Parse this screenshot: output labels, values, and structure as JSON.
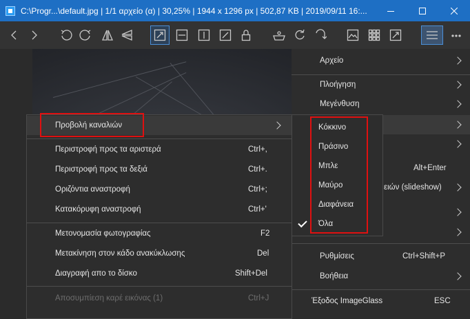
{
  "window": {
    "title": "C:\\Progr...\\default.jpg  |  1/1 αρχείο (α)  |  30,25%  |  1944 x 1296 px  |  502,87 KB  |  2019/09/11 16:..."
  },
  "main_menu": {
    "items": [
      {
        "label": "Αρχείο"
      },
      {
        "label": "Πλοήγηση"
      },
      {
        "label": "Μεγένθυση"
      },
      {
        "label": ""
      },
      {
        "label": ""
      },
      {
        "label": "",
        "shortcut": "Alt+Enter"
      },
      {
        "label": "ειών (slideshow)"
      },
      {
        "label": ""
      },
      {
        "label": ""
      },
      {
        "label": "Ρυθμίσεις",
        "shortcut": "Ctrl+Shift+P"
      },
      {
        "label": "Βοήθεια"
      },
      {
        "label": "Έξοδος ImageGlass",
        "shortcut": "ESC"
      }
    ]
  },
  "sub_menu": {
    "items": [
      {
        "label": "Προβολή καναλιών",
        "shortcut": ""
      },
      {
        "label": "Περιστροφή προς τα αριστερά",
        "shortcut": "Ctrl+,"
      },
      {
        "label": "Περιστροφή προς τα δεξιά",
        "shortcut": "Ctrl+."
      },
      {
        "label": "Οριζόντια αναστροφή",
        "shortcut": "Ctrl+;"
      },
      {
        "label": "Κατακόρυφη αναστροφή",
        "shortcut": "Ctrl+'"
      },
      {
        "label": "Μετονομασία φωτογραφίας",
        "shortcut": "F2"
      },
      {
        "label": "Μετακίνηση στον κάδο ανακύκλωσης",
        "shortcut": "Del"
      },
      {
        "label": "Διαγραφή απο το δίσκο",
        "shortcut": "Shift+Del"
      },
      {
        "label": "Αποσυμπίεση καρέ εικόνας (1)",
        "shortcut": "Ctrl+J"
      }
    ]
  },
  "channel_menu": {
    "items": [
      {
        "label": "Κόκκινο",
        "checked": false
      },
      {
        "label": "Πράσινο",
        "checked": false
      },
      {
        "label": "Μπλε",
        "checked": false
      },
      {
        "label": "Μαύρο",
        "checked": false
      },
      {
        "label": "Διαφάνεια",
        "checked": false
      },
      {
        "label": "Όλα",
        "checked": true
      }
    ]
  },
  "colors": {
    "titlebar": "#1e6fc4",
    "menu_bg": "#2d2d2d",
    "highlight_box": "#e01010",
    "active_button": "#4a90d9"
  }
}
